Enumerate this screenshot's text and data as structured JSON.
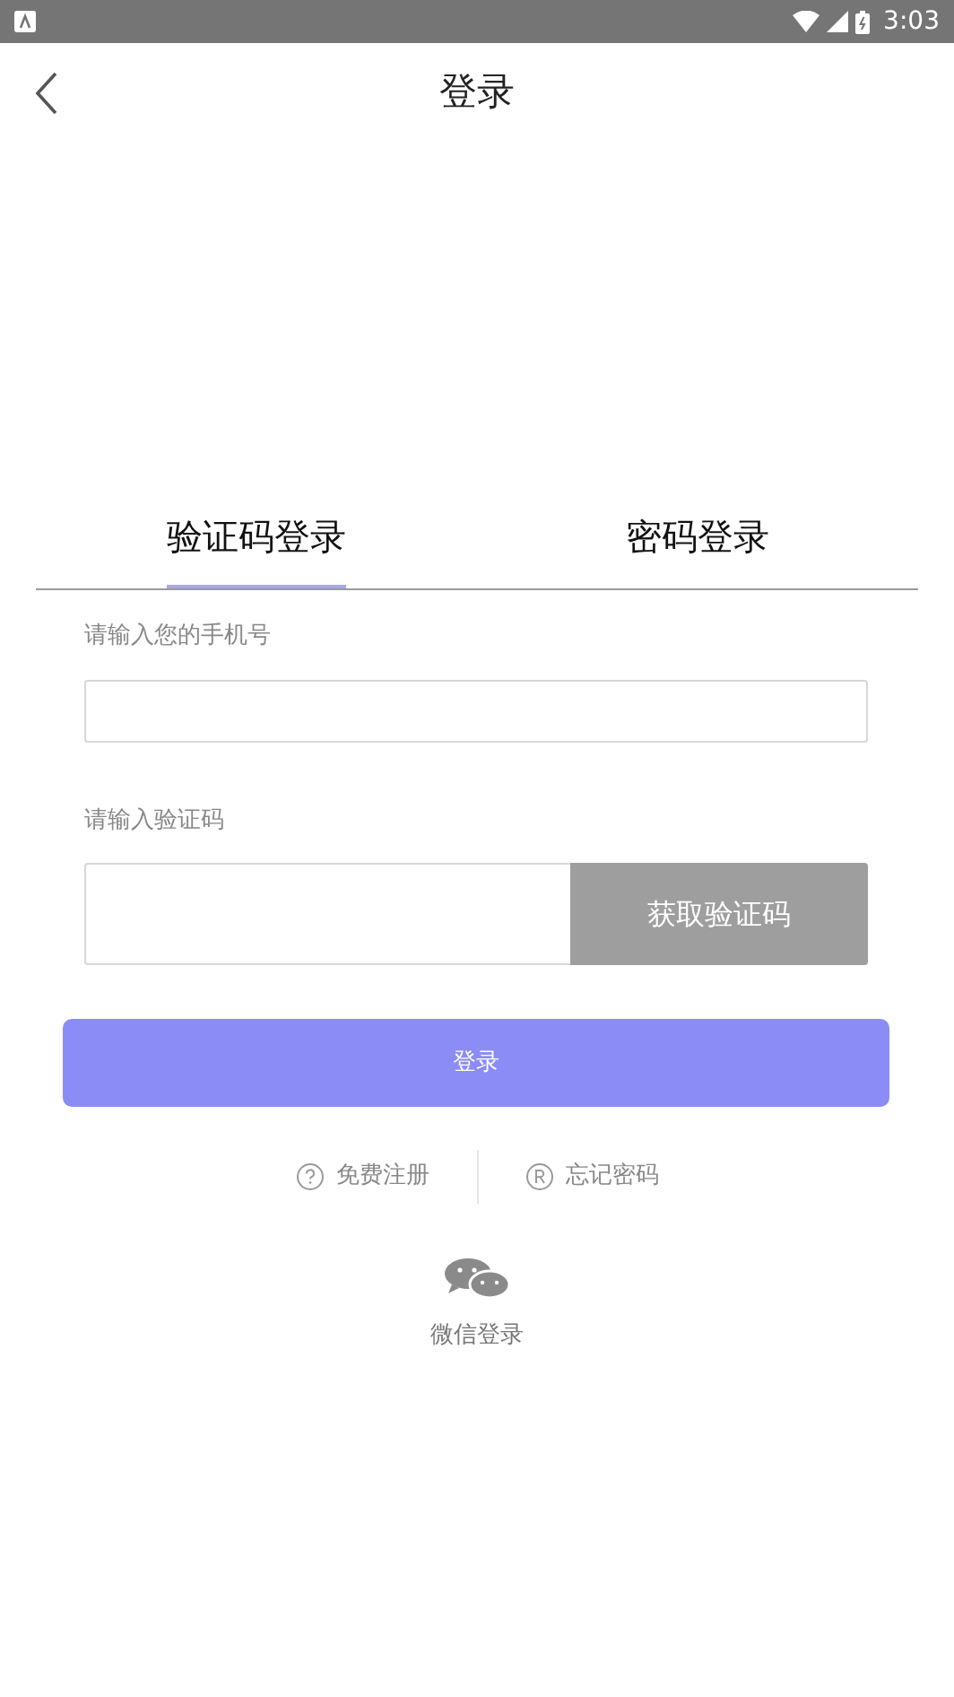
{
  "status_bar": {
    "time": "3:03"
  },
  "header": {
    "title": "登录"
  },
  "tabs": [
    {
      "label": "验证码登录",
      "selected": true
    },
    {
      "label": "密码登录",
      "selected": false
    }
  ],
  "phone_field": {
    "label": "请输入您的手机号"
  },
  "code_field": {
    "label": "请输入验证码",
    "button": "获取验证码"
  },
  "login_button": "登录",
  "links": [
    {
      "label": "免费注册",
      "kind": "register"
    },
    {
      "label": "忘记密码",
      "kind": "forgot"
    }
  ],
  "wechat_login": "微信登录"
}
